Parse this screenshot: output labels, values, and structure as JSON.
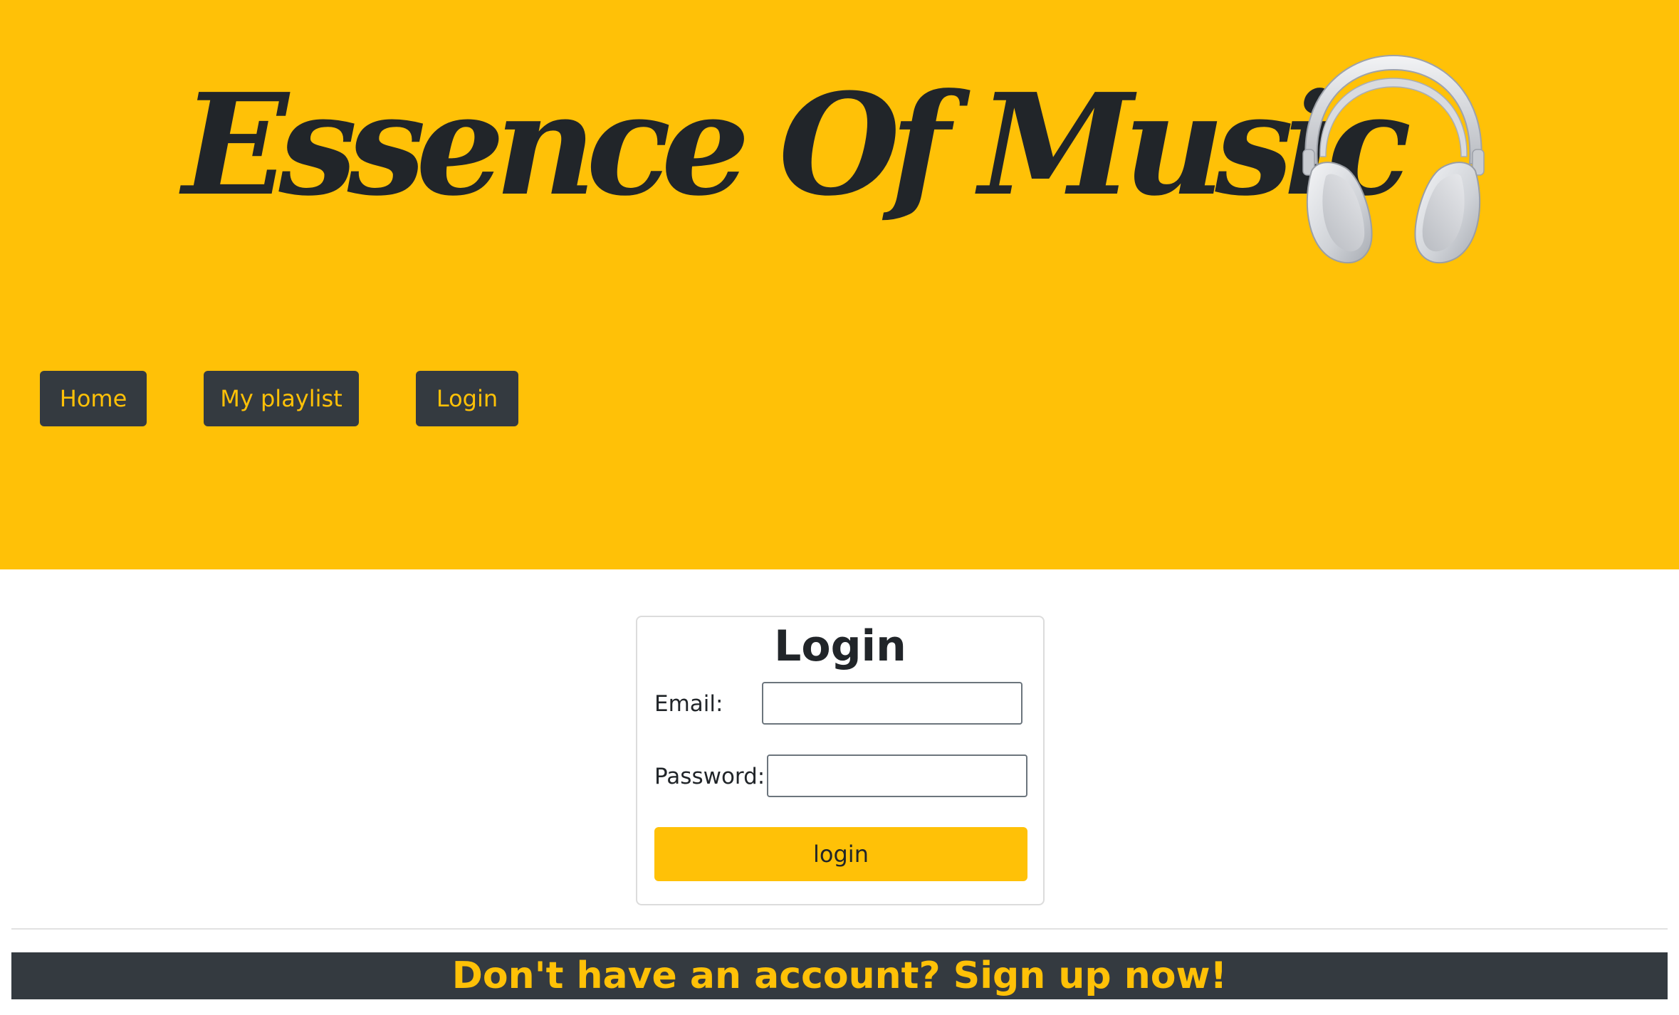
{
  "header": {
    "title": "Essence Of Music",
    "icon": "headphones-icon",
    "background_color": "#ffc107",
    "text_color": "#212529"
  },
  "nav": {
    "items": [
      {
        "label": "Home"
      },
      {
        "label": "My playlist"
      },
      {
        "label": "Login"
      }
    ],
    "button_color": "#343a40",
    "label_color": "#ffc107"
  },
  "login_form": {
    "title": "Login",
    "email_label": "Email:",
    "email_value": "",
    "password_label": "Password:",
    "password_value": "",
    "submit_label": "login",
    "submit_color": "#ffc107"
  },
  "signup_banner": {
    "text": "Don't have an account? Sign up now!",
    "background_color": "#343a40",
    "text_color": "#ffc107"
  }
}
